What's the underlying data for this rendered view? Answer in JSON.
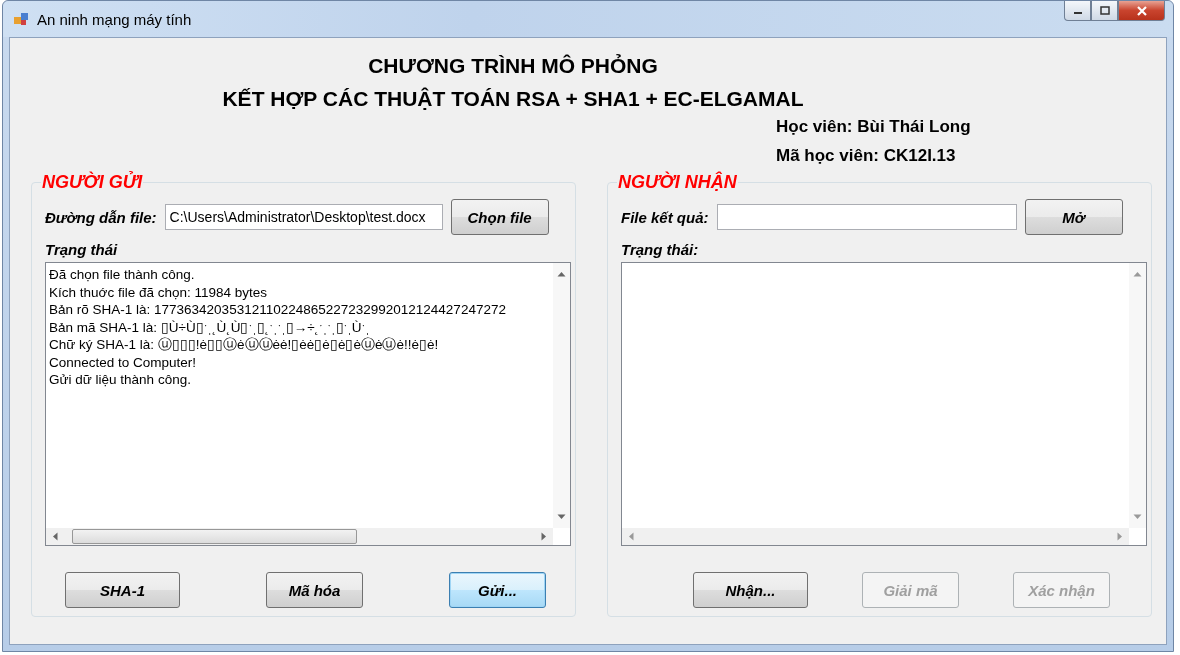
{
  "window": {
    "title": "An ninh mạng máy tính"
  },
  "heading": [
    "CHƯƠNG TRÌNH MÔ PHỎNG",
    "KẾT HỢP CÁC THUẬT TOÁN RSA + SHA1 + EC-ELGAMAL"
  ],
  "student": [
    "Học viên: Bùi Thái Long",
    "Mã học viên: CK12I.13"
  ],
  "sender": {
    "title": "NGƯỜI GỬI",
    "path_label": "Đường dẫn file:",
    "path_value": "C:\\Users\\Administrator\\Desktop\\test.docx",
    "choose_button": "Chọn file",
    "status_label": "Trạng thái",
    "log": [
      "Đã chọn file thành công.",
      "Kích thuớc file đã chọn: 11984 bytes",
      "Bản rõ SHA-1 là: 17736342035312110224865227232992012124427247272",
      "Bản mã SHA-1 là: ▯Ù÷Ù▯ˑˌ˛Ù˛Ù▯ˑˌ▯˛ˑˌˑˌ▯→÷˛ˑˌˑˌ▯ˑˌÙˑˌ",
      "Chữ ký SHA-1 là: ⓤ▯▯▯!ė▯▯ⓤėⓤⓤėė!▯ėė▯ė▯ė▯ėⓤėⓤė!!ė▯ė!",
      "Connected to Computer!",
      "Gửi dữ liệu thành công."
    ],
    "buttons": [
      {
        "label": "SHA-1",
        "disabled": false,
        "focused": false
      },
      {
        "label": "Mã hóa",
        "disabled": false,
        "focused": false
      },
      {
        "label": "Gửi...",
        "disabled": false,
        "focused": true
      }
    ]
  },
  "receiver": {
    "title": "NGƯỜI NHẬN",
    "result_label": "File kết quả:",
    "open_button": "Mở",
    "status_label": "Trạng thái:",
    "buttons": [
      {
        "label": "Nhận...",
        "disabled": false,
        "focused": false
      },
      {
        "label": "Giải mã",
        "disabled": true,
        "focused": false
      },
      {
        "label": "Xác nhận",
        "disabled": true,
        "focused": false
      }
    ]
  }
}
